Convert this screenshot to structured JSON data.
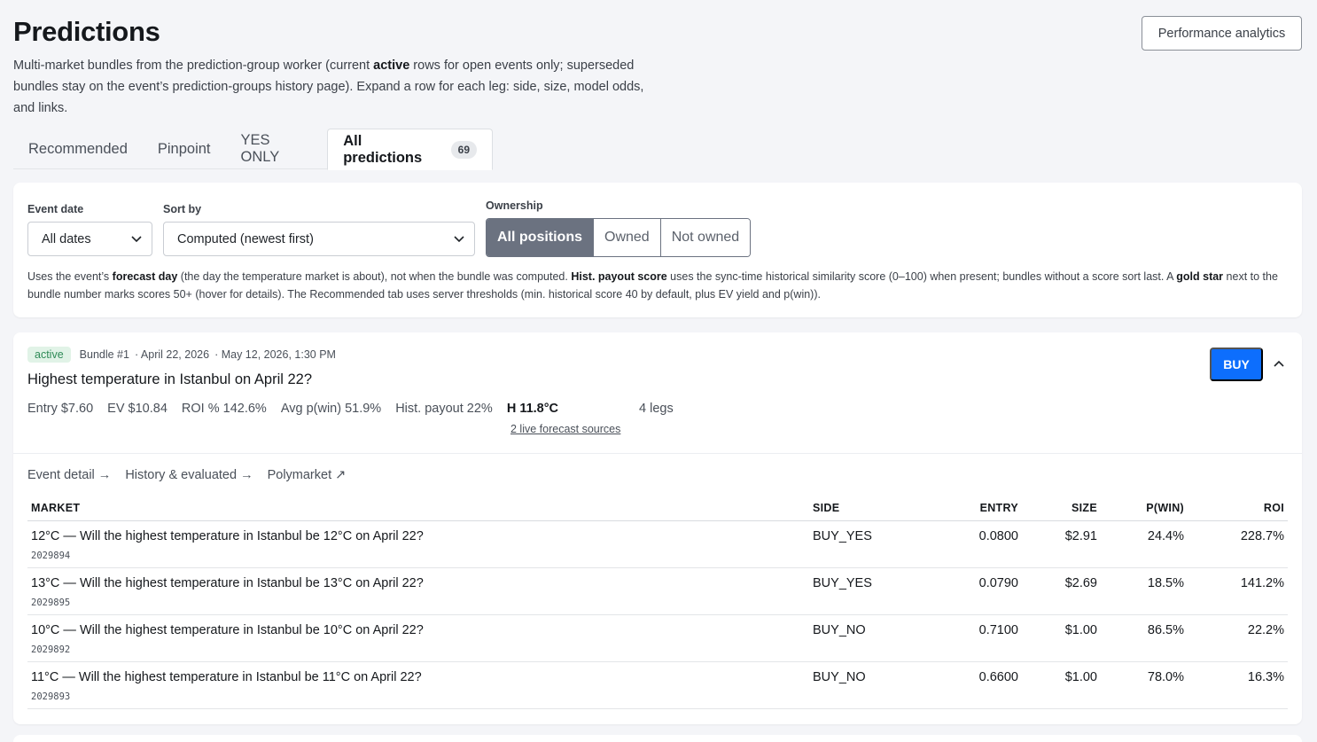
{
  "header": {
    "title": "Predictions",
    "subtitle_parts": [
      "Multi-market bundles from the prediction-group worker (current ",
      "active",
      " rows for open events only; superseded bundles stay on the event’s prediction-groups history page). Expand a row for each leg: side, size, model odds, and links."
    ]
  },
  "actions": {
    "performance_label": "Performance analytics"
  },
  "tabs": [
    {
      "label": "Recommended"
    },
    {
      "label": "Pinpoint"
    },
    {
      "label": "YES ONLY"
    },
    {
      "label": "All predictions",
      "count": "69",
      "active": true
    }
  ],
  "filters": {
    "event_date": {
      "label": "Event date",
      "value": "All dates"
    },
    "sort_by": {
      "label": "Sort by",
      "value": "Computed (newest first)"
    },
    "ownership": {
      "label": "Ownership",
      "options": [
        "All positions",
        "Owned",
        "Not owned"
      ],
      "selected": "All positions"
    },
    "note_parts": [
      "Uses the event’s ",
      "forecast day",
      " (the day the temperature market is about), not when the bundle was computed. ",
      "Hist. payout score",
      " uses the sync-time historical similarity score (0–100) when present; bundles without a score sort last. A ",
      "gold star",
      " next to the bundle number marks scores 50+ (hover for details). The Recommended tab uses server thresholds (min. historical score 40 by default, plus EV yield and p(win))."
    ]
  },
  "bundle": {
    "status": "active",
    "number": "Bundle #1",
    "event_date": "· April 22, 2026",
    "computed": "· May 12, 2026, 1:30 PM",
    "title": "Highest temperature in Istanbul on April 22?",
    "stats": {
      "entry": "Entry $7.60",
      "ev": "EV $10.84",
      "roi": "ROI % 142.6%",
      "avg_pwin": "Avg p(win) 51.9%",
      "hist_payout": "Hist. payout 22%",
      "high": "H 11.8°C",
      "forecast_sources": "2 live forecast sources",
      "legs": "4 legs"
    },
    "buy_label": "BUY",
    "links": [
      "Event detail →",
      "History & evaluated →",
      "Polymarket ↗"
    ],
    "table": {
      "headers": [
        "MARKET",
        "SIDE",
        "ENTRY",
        "SIZE",
        "P(WIN)",
        "ROI"
      ],
      "rows": [
        {
          "market": "12°C — Will the highest temperature in Istanbul be 12°C on April 22?",
          "id": "2029894",
          "side": "BUY_YES",
          "entry": "0.0800",
          "size": "$2.91",
          "pwin": "24.4%",
          "roi": "228.7%"
        },
        {
          "market": "13°C — Will the highest temperature in Istanbul be 13°C on April 22?",
          "id": "2029895",
          "side": "BUY_YES",
          "entry": "0.0790",
          "size": "$2.69",
          "pwin": "18.5%",
          "roi": "141.2%"
        },
        {
          "market": "10°C — Will the highest temperature in Istanbul be 10°C on April 22?",
          "id": "2029892",
          "side": "BUY_NO",
          "entry": "0.7100",
          "size": "$1.00",
          "pwin": "86.5%",
          "roi": "22.2%"
        },
        {
          "market": "11°C — Will the highest temperature in Istanbul be 11°C on April 22?",
          "id": "2029893",
          "side": "BUY_NO",
          "entry": "0.6600",
          "size": "$1.00",
          "pwin": "78.0%",
          "roi": "16.3%"
        }
      ]
    }
  },
  "icons": {
    "select_chevron": "chevron-down-icon",
    "collapse": "chevron-up-icon"
  },
  "colors": {
    "buy": "#0d6efd",
    "active_badge_bg": "#e1f3e7",
    "active_badge_text": "#2e8b57",
    "segment_active": "#6b7280"
  }
}
